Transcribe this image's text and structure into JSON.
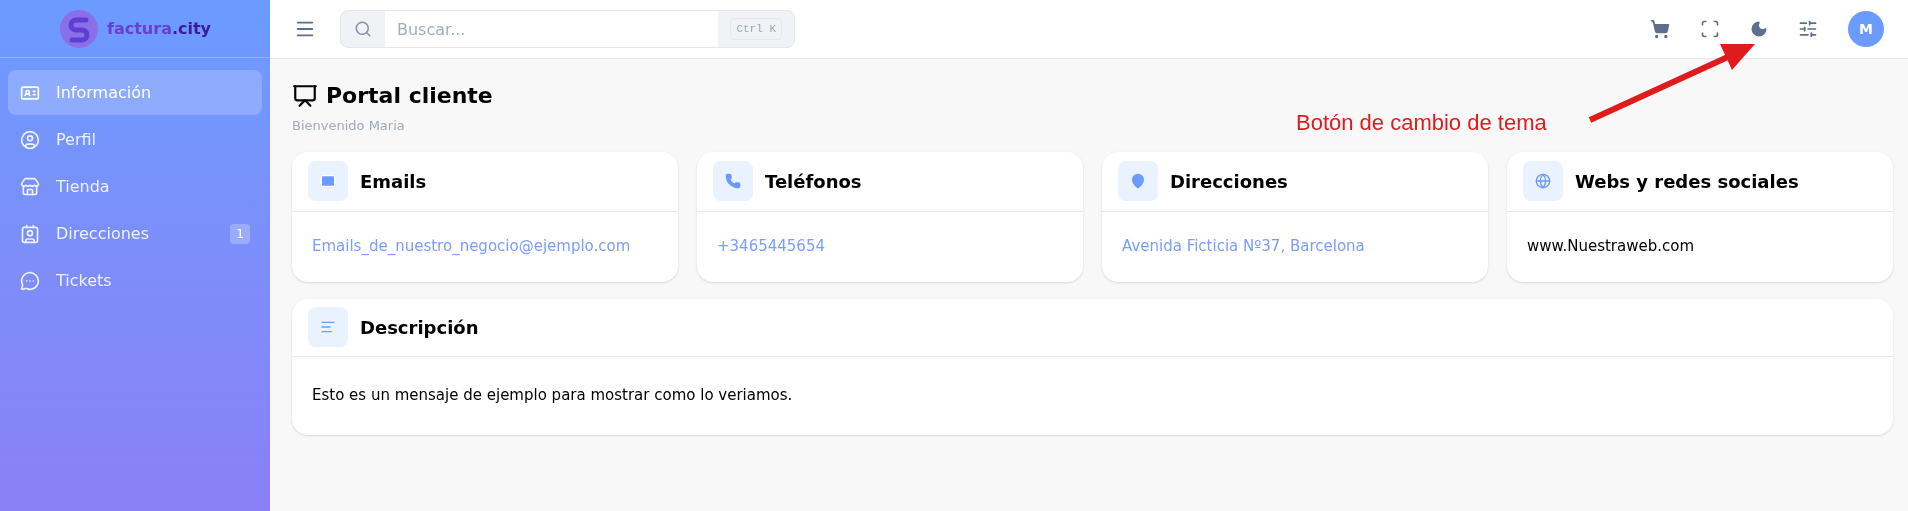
{
  "brand": {
    "name": "factura",
    "suffix": ".city"
  },
  "sidebar": {
    "items": [
      {
        "label": "Información",
        "selected": true
      },
      {
        "label": "Perfil",
        "selected": false
      },
      {
        "label": "Tienda",
        "selected": false
      },
      {
        "label": "Direcciones",
        "selected": false,
        "badge": "1"
      },
      {
        "label": "Tickets",
        "selected": false
      }
    ]
  },
  "topbar": {
    "search": {
      "placeholder": "Buscar...",
      "shortcut": "Ctrl K"
    },
    "avatar": "M"
  },
  "page": {
    "title": "Portal cliente",
    "subtitle": "Bienvenido Maria"
  },
  "cards": [
    {
      "title": "Emails",
      "kind": "link",
      "value": "Emails_de_nuestro_negocio@ejemplo.com"
    },
    {
      "title": "Teléfonos",
      "kind": "link",
      "value": "+3465445654"
    },
    {
      "title": "Direcciones",
      "kind": "link",
      "value": "Avenida Ficticia Nº37, Barcelona"
    },
    {
      "title": "Webs y redes sociales",
      "kind": "text",
      "value": "www.Nuestraweb.com"
    }
  ],
  "description": {
    "title": "Descripción",
    "text": "Esto es un mensaje de ejemplo para mostrar como lo veriamos."
  },
  "annotation": {
    "text": "Botón de cambio de tema"
  }
}
